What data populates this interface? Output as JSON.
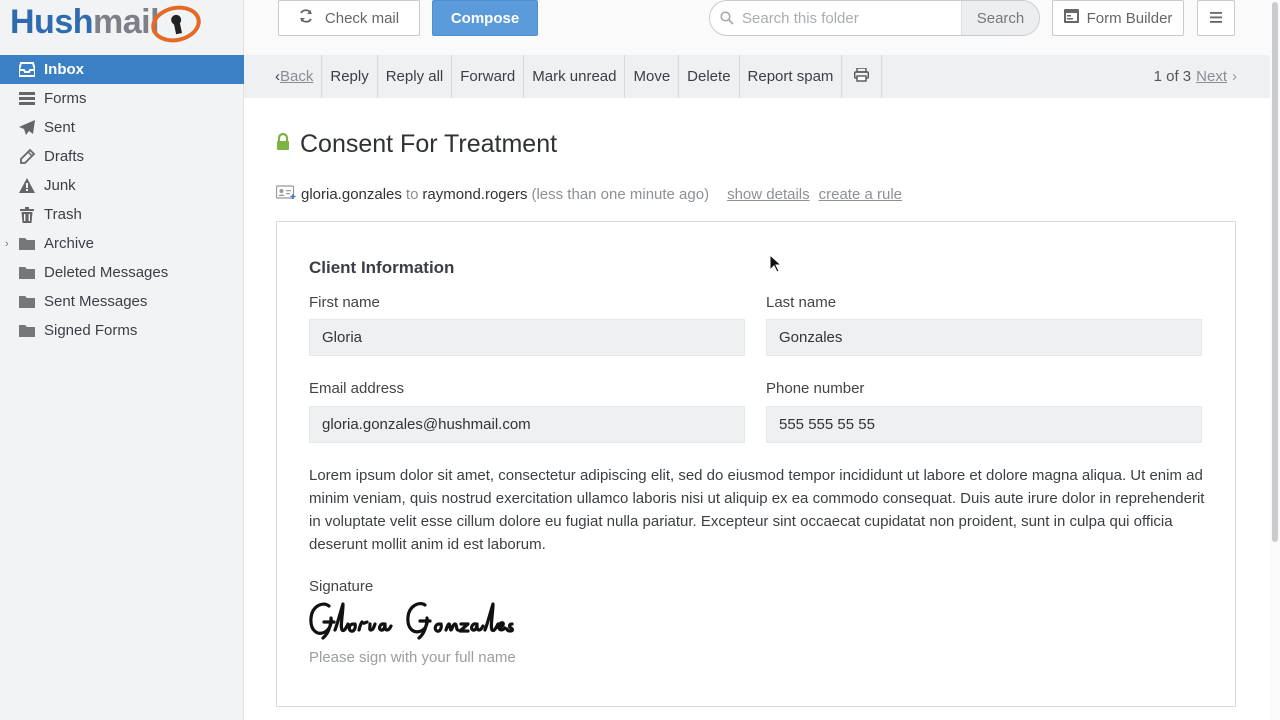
{
  "logo": {
    "part1": "Hush",
    "part2": "mail"
  },
  "folders": [
    {
      "label": "Inbox",
      "icon": "inbox-icon"
    },
    {
      "label": "Forms",
      "icon": "list-icon"
    },
    {
      "label": "Sent",
      "icon": "paper-plane-icon"
    },
    {
      "label": "Drafts",
      "icon": "pencil-icon"
    },
    {
      "label": "Junk",
      "icon": "warning-icon"
    },
    {
      "label": "Trash",
      "icon": "trash-icon"
    },
    {
      "label": "Archive",
      "icon": "folder-icon"
    },
    {
      "label": "Deleted Messages",
      "icon": "folder-icon"
    },
    {
      "label": "Sent Messages",
      "icon": "folder-icon"
    },
    {
      "label": "Signed Forms",
      "icon": "folder-icon"
    }
  ],
  "header": {
    "check_mail": "Check mail",
    "compose": "Compose",
    "search_placeholder": "Search this folder",
    "search_button": "Search",
    "form_builder": "Form Builder"
  },
  "toolbar": {
    "back": "Back",
    "reply": "Reply",
    "reply_all": "Reply all",
    "forward": "Forward",
    "mark_unread": "Mark unread",
    "move": "Move",
    "delete": "Delete",
    "report_spam": "Report spam",
    "pager_text": "1 of 3",
    "next": "Next"
  },
  "message": {
    "subject": "Consent For Treatment",
    "from": "gloria.gonzales",
    "to_word": "to",
    "to": "raymond.rogers",
    "time": "(less than one minute ago)",
    "show_details": "show details",
    "create_rule": "create a rule"
  },
  "form": {
    "section_title": "Client Information",
    "first_name_label": "First name",
    "first_name": "Gloria",
    "last_name_label": "Last name",
    "last_name": "Gonzales",
    "email_label": "Email address",
    "email": "gloria.gonzales@hushmail.com",
    "phone_label": "Phone number",
    "phone": "555 555 55 55",
    "body": "Lorem ipsum dolor sit amet, consectetur adipiscing elit, sed do eiusmod tempor incididunt ut labore et dolore magna aliqua. Ut enim ad minim veniam, quis nostrud exercitation ullamco laboris nisi ut aliquip ex ea commodo consequat. Duis aute irure dolor in reprehenderit in voluptate velit esse cillum dolore eu fugiat nulla pariatur. Excepteur sint occaecat cupidatat non proident, sunt in culpa qui officia deserunt mollit anim id est laborum.",
    "signature_label": "Signature",
    "signature": "Gloria Gonzales",
    "signature_hint": "Please sign with your full name"
  },
  "colors": {
    "accent": "#3b7fc4",
    "compose": "#5b9bd9",
    "logo_blue": "#2f6bae",
    "logo_orange": "#e56b25",
    "lock_green": "#7cb342"
  }
}
